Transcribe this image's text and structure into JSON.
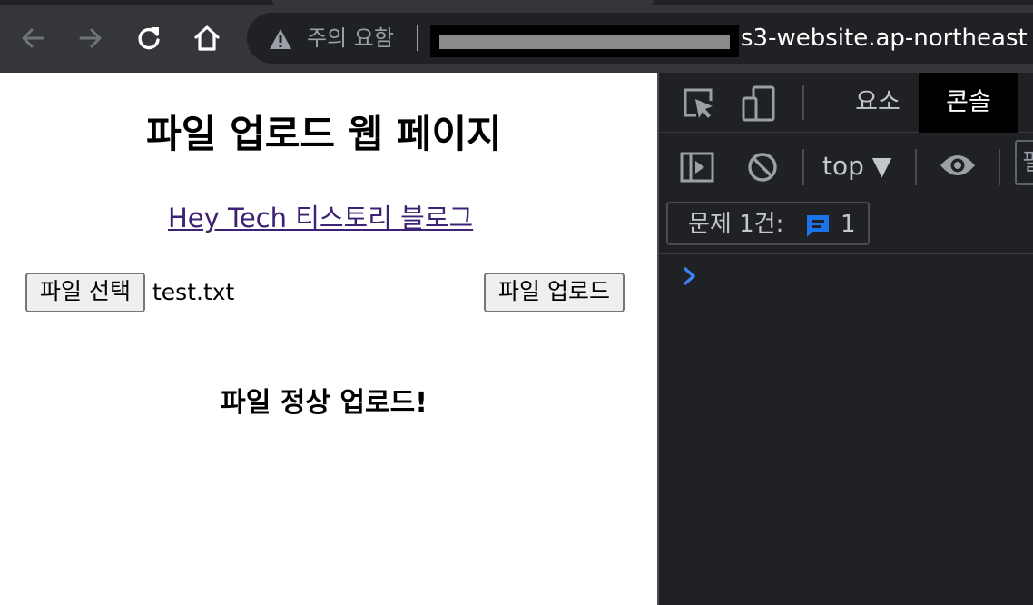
{
  "browser": {
    "security_warning": "주의 요함",
    "url_visible": "s3-website.ap-northeast"
  },
  "page": {
    "heading": "파일 업로드 웹 페이지",
    "blog_link": "Hey Tech 티스토리 블로그",
    "choose_file_label": "파일 선택",
    "chosen_file_name": "test.txt",
    "upload_label": "파일 업로드",
    "status_message": "파일 정상 업로드!"
  },
  "devtools": {
    "tabs": [
      "요소",
      "콘솔"
    ],
    "active_tab": "콘솔",
    "context": "top ▼",
    "filter_partial": "필",
    "issues_label": "문제 1건:",
    "issues_count": "1"
  },
  "colors": {
    "toolbar_bg": "#35363a",
    "devtools_bg": "#202124",
    "link": "#3c2175",
    "issue_icon": "#1a73e8",
    "prompt_chevron": "#3b82f6"
  }
}
